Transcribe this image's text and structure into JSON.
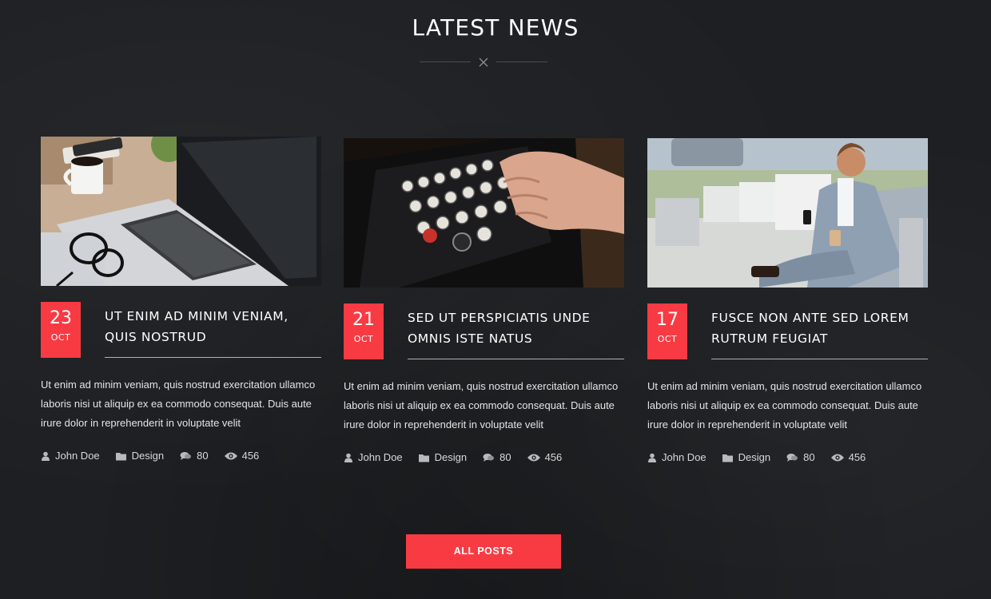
{
  "section": {
    "title": "LATEST NEWS"
  },
  "posts": [
    {
      "day": "23",
      "month": "OCT",
      "title_line1": "UT ENIM AD MINIM VENIAM,",
      "title_line2": "QUIS NOSTRUD",
      "excerpt": "Ut enim ad minim veniam, quis nostrud exercitation ullamco laboris nisi ut aliquip ex ea commodo consequat. Duis aute irure dolor in reprehenderit in voluptate velit",
      "author": "John Doe",
      "category": "Design",
      "comments": "80",
      "views": "456",
      "image": "laptop-desk-photo"
    },
    {
      "day": "21",
      "month": "OCT",
      "title_line1": "SED UT PERSPICIATIS UNDE",
      "title_line2": "OMNIS ISTE NATUS",
      "excerpt": "Ut enim ad minim veniam, quis nostrud exercitation ullamco laboris nisi ut aliquip ex ea commodo consequat. Duis aute irure dolor in reprehenderit in voluptate velit",
      "author": "John Doe",
      "category": "Design",
      "comments": "80",
      "views": "456",
      "image": "typewriter-photo"
    },
    {
      "day": "17",
      "month": "OCT",
      "title_line1": "FUSCE NON ANTE SED LOREM",
      "title_line2": "RUTRUM FEUGIAT",
      "excerpt": "Ut enim ad minim veniam, quis nostrud exercitation ullamco laboris nisi ut aliquip ex ea commodo consequat. Duis aute irure dolor in reprehenderit in voluptate velit",
      "author": "John Doe",
      "category": "Design",
      "comments": "80",
      "views": "456",
      "image": "businessman-phone-photo"
    }
  ],
  "button": {
    "label": "ALL POSTS"
  },
  "colors": {
    "accent": "#f83b43",
    "background": "#1d1f22"
  },
  "icons": {
    "author": "user-icon",
    "category": "folder-icon",
    "comments": "comments-icon",
    "views": "eye-icon",
    "divider": "close-x-icon"
  }
}
